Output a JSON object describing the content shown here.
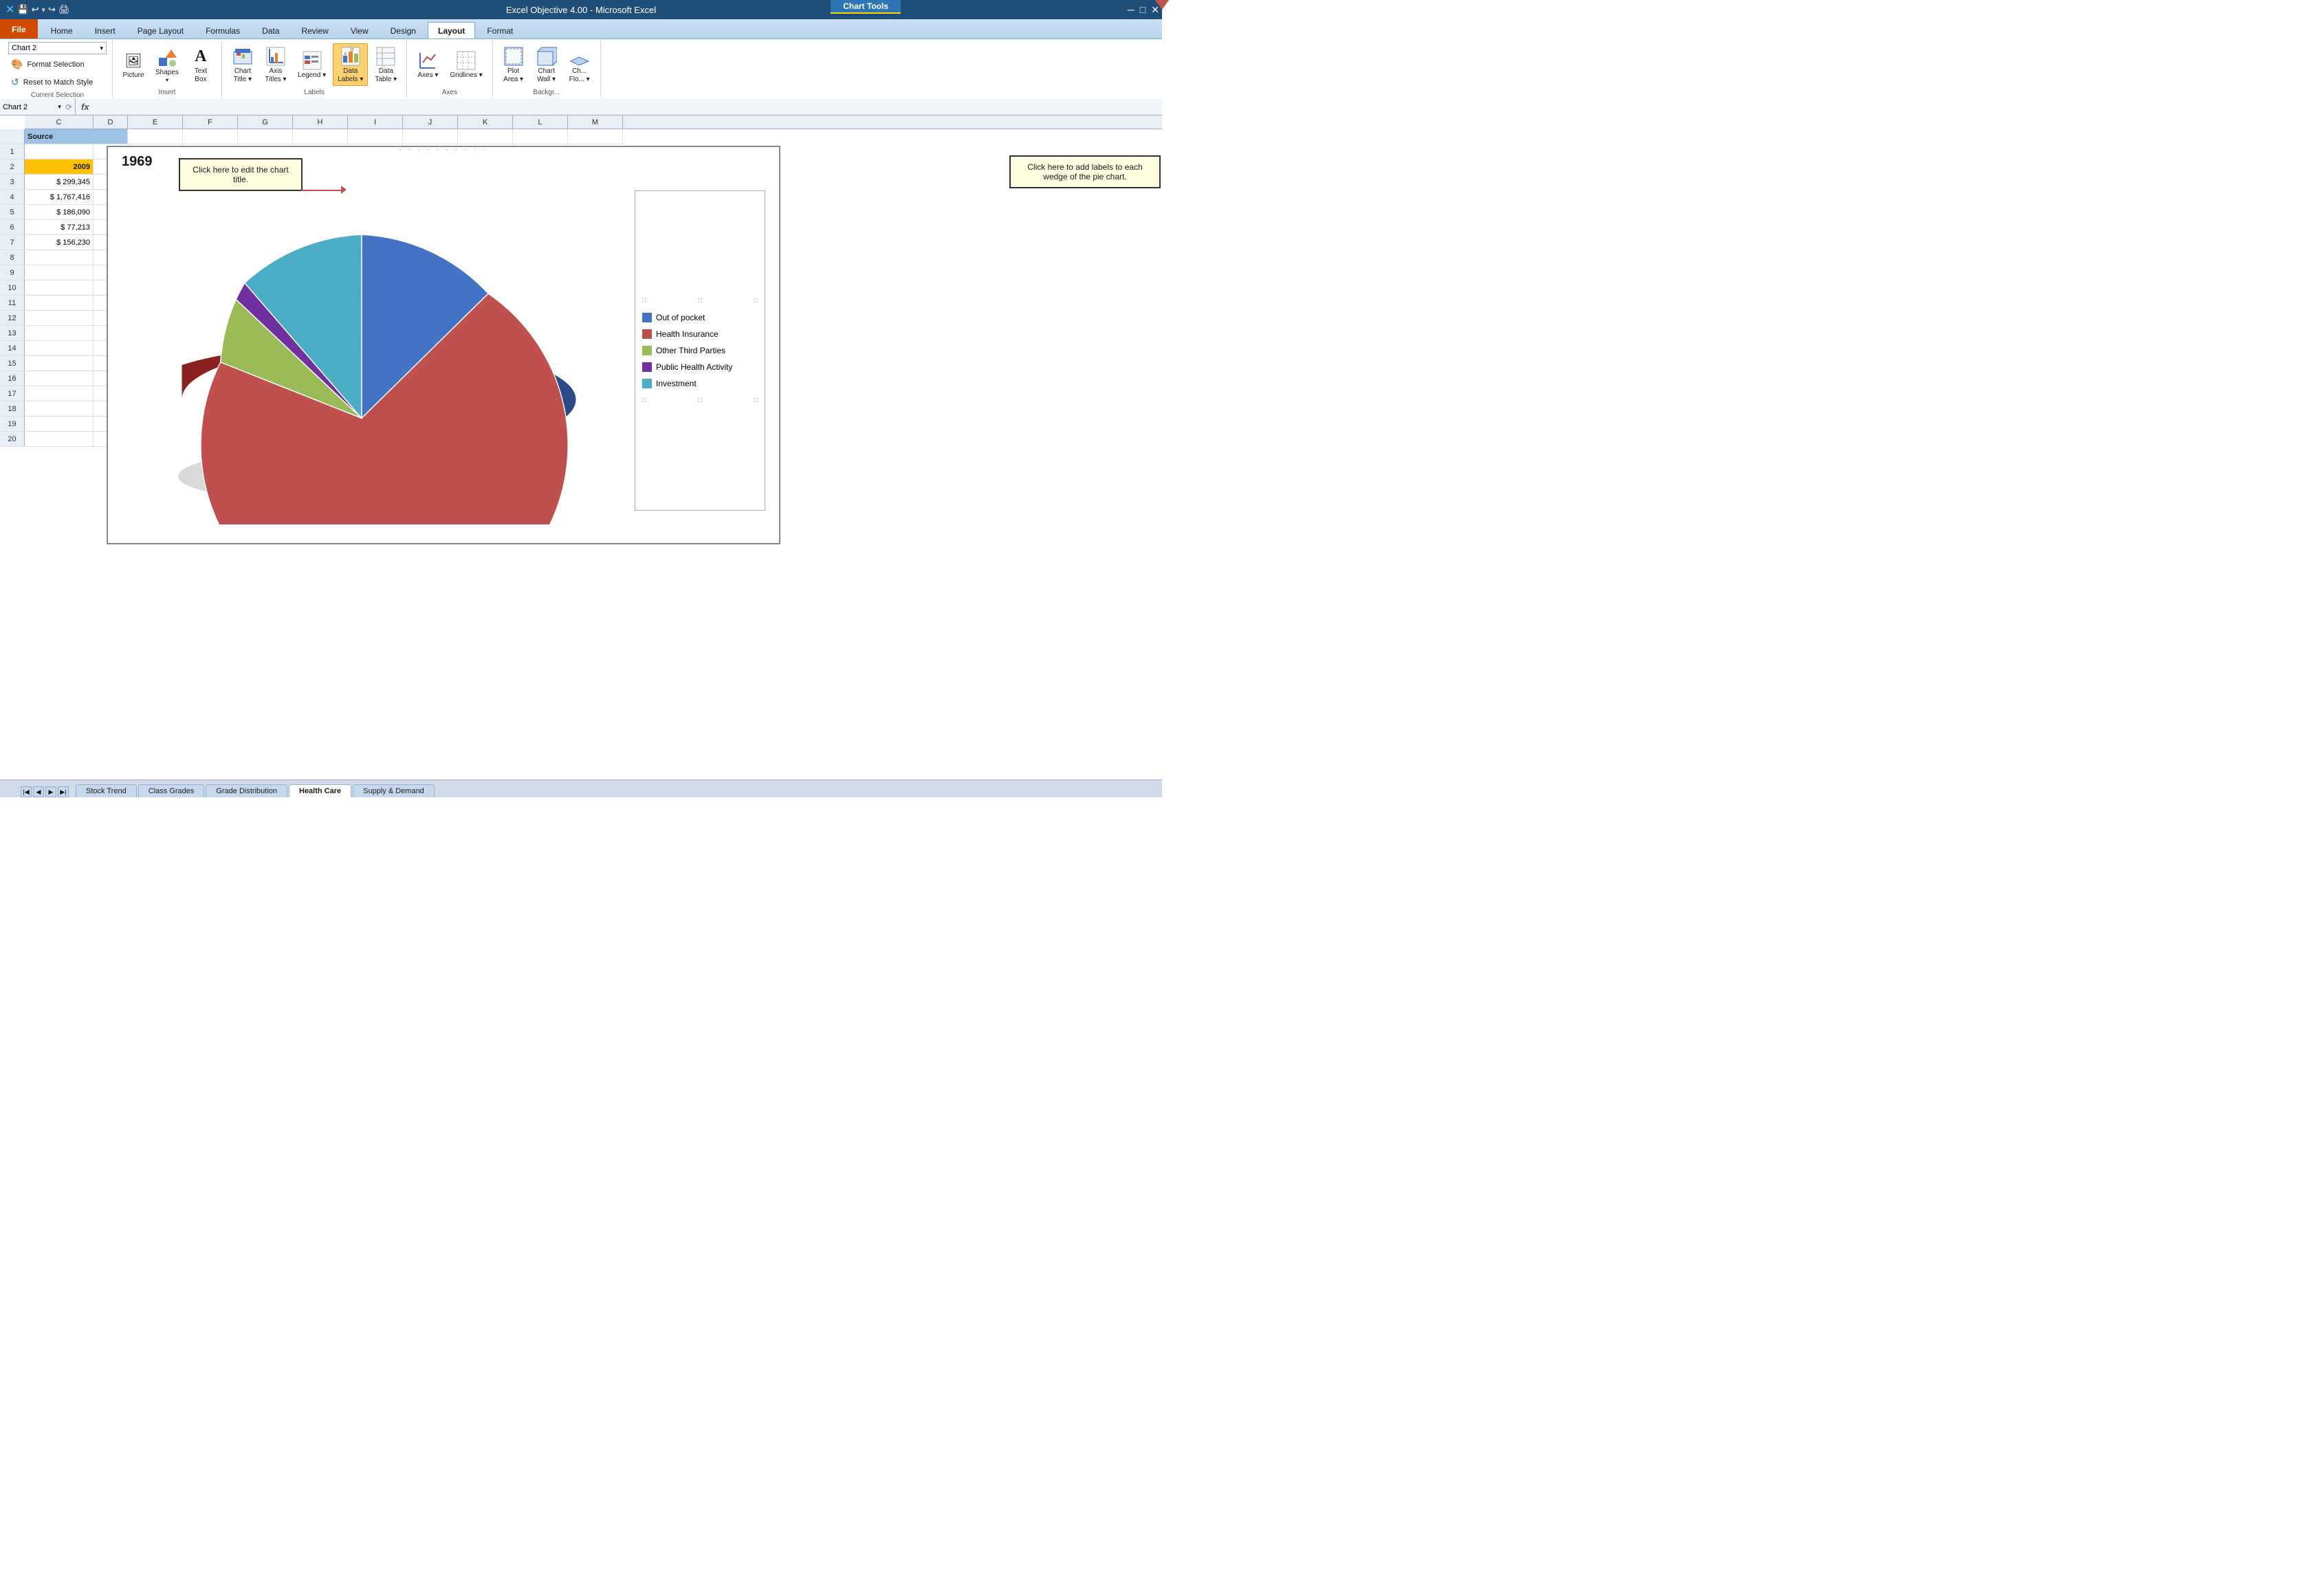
{
  "titleBar": {
    "title": "Excel Objective 4.00 - Microsoft Excel",
    "chartToolsBadge": "Chart Tools"
  },
  "ribbon": {
    "tabs": [
      {
        "id": "file",
        "label": "File",
        "type": "file"
      },
      {
        "id": "home",
        "label": "Home"
      },
      {
        "id": "insert",
        "label": "Insert"
      },
      {
        "id": "pageLayout",
        "label": "Page Layout"
      },
      {
        "id": "formulas",
        "label": "Formulas"
      },
      {
        "id": "data",
        "label": "Data"
      },
      {
        "id": "review",
        "label": "Review"
      },
      {
        "id": "view",
        "label": "View"
      },
      {
        "id": "design",
        "label": "Design"
      },
      {
        "id": "layout",
        "label": "Layout",
        "active": true
      },
      {
        "id": "format",
        "label": "Format"
      }
    ],
    "groups": {
      "currentSelection": {
        "label": "Current Selection",
        "selectorValue": "Chart 2",
        "formatBtn": "Format Selection",
        "resetBtn": "Reset to Match Style"
      },
      "insert": {
        "label": "Insert",
        "buttons": [
          {
            "id": "picture",
            "label": "Picture",
            "icon": "🖼"
          },
          {
            "id": "shapes",
            "label": "Shapes",
            "icon": "⬡"
          },
          {
            "id": "textBox",
            "label": "Text Box",
            "icon": "A"
          }
        ]
      },
      "labels": {
        "label": "Labels",
        "buttons": [
          {
            "id": "chartTitle",
            "label": "Chart Title",
            "icon": "📊"
          },
          {
            "id": "axisTitles",
            "label": "Axis Titles",
            "icon": "📈"
          },
          {
            "id": "legend",
            "label": "Legend",
            "icon": "☰"
          },
          {
            "id": "dataLabels",
            "label": "Data Labels",
            "icon": "📋",
            "active": true
          },
          {
            "id": "dataTable",
            "label": "Data Table",
            "icon": "▦"
          }
        ]
      },
      "axes": {
        "label": "Axes",
        "buttons": [
          {
            "id": "axes",
            "label": "Axes",
            "icon": "⊞"
          },
          {
            "id": "gridlines",
            "label": "Gridlines",
            "icon": "⊟"
          }
        ]
      },
      "background": {
        "label": "Background",
        "buttons": [
          {
            "id": "plotArea",
            "label": "Plot Area",
            "icon": "▣"
          },
          {
            "id": "chartWall",
            "label": "Chart Wall",
            "icon": "▢"
          },
          {
            "id": "chartFloor",
            "label": "Ch... Flo...",
            "icon": "▤"
          }
        ]
      }
    }
  },
  "formulaBar": {
    "cellRef": "Chart 2",
    "formula": "fx"
  },
  "spreadsheet": {
    "columns": [
      {
        "label": "C",
        "width": 100
      },
      {
        "label": "D",
        "width": 50
      },
      {
        "label": "E",
        "width": 80
      },
      {
        "label": "F",
        "width": 80
      },
      {
        "label": "G",
        "width": 80
      },
      {
        "label": "H",
        "width": 80
      },
      {
        "label": "I",
        "width": 80
      },
      {
        "label": "J",
        "width": 80
      },
      {
        "label": "K",
        "width": 80
      },
      {
        "label": "L",
        "width": 80
      },
      {
        "label": "M",
        "width": 80
      }
    ],
    "rows": [
      {
        "rowNum": "",
        "cells": [
          {
            "value": "Source",
            "type": "header-cell",
            "span": 2
          },
          {
            "value": "",
            "type": ""
          },
          {
            "value": "",
            "type": ""
          },
          {
            "value": "",
            "type": ""
          },
          {
            "value": "",
            "type": ""
          }
        ]
      },
      {
        "rowNum": "1",
        "cells": [
          {
            "value": "",
            "type": ""
          },
          {
            "value": "",
            "type": ""
          },
          {
            "value": "",
            "type": ""
          },
          {
            "value": "",
            "type": ""
          },
          {
            "value": "",
            "type": ""
          }
        ]
      },
      {
        "rowNum": "2",
        "cells": [
          {
            "value": "2009",
            "type": "year-cell"
          },
          {
            "value": "",
            "type": ""
          },
          {
            "value": "",
            "type": ""
          },
          {
            "value": "",
            "type": ""
          },
          {
            "value": "",
            "type": ""
          }
        ]
      },
      {
        "rowNum": "3",
        "cells": [
          {
            "value": "$ 299,345",
            "type": "money"
          },
          {
            "value": "",
            "type": ""
          },
          {
            "value": "",
            "type": ""
          },
          {
            "value": "",
            "type": ""
          },
          {
            "value": "",
            "type": ""
          }
        ]
      },
      {
        "rowNum": "4",
        "cells": [
          {
            "value": "$ 1,767,416",
            "type": "money"
          },
          {
            "value": "",
            "type": ""
          },
          {
            "value": "",
            "type": ""
          },
          {
            "value": "",
            "type": ""
          },
          {
            "value": "",
            "type": ""
          }
        ]
      },
      {
        "rowNum": "5",
        "cells": [
          {
            "value": "$ 186,090",
            "type": "money"
          },
          {
            "value": "",
            "type": ""
          },
          {
            "value": "",
            "type": ""
          },
          {
            "value": "",
            "type": ""
          },
          {
            "value": "",
            "type": ""
          }
        ]
      },
      {
        "rowNum": "6",
        "cells": [
          {
            "value": "$ 77,213",
            "type": "money"
          },
          {
            "value": "",
            "type": ""
          },
          {
            "value": "",
            "type": ""
          },
          {
            "value": "",
            "type": ""
          },
          {
            "value": "",
            "type": ""
          }
        ]
      },
      {
        "rowNum": "7",
        "cells": [
          {
            "value": "$ 156,230",
            "type": "money"
          },
          {
            "value": "",
            "type": ""
          },
          {
            "value": "",
            "type": ""
          },
          {
            "value": "",
            "type": ""
          },
          {
            "value": "",
            "type": ""
          }
        ]
      },
      {
        "rowNum": "8",
        "cells": [
          {
            "value": "",
            "type": ""
          },
          {
            "value": "",
            "type": ""
          },
          {
            "value": "",
            "type": ""
          },
          {
            "value": "",
            "type": ""
          },
          {
            "value": "",
            "type": ""
          }
        ]
      },
      {
        "rowNum": "9",
        "cells": [
          {
            "value": "",
            "type": ""
          },
          {
            "value": "",
            "type": ""
          },
          {
            "value": "",
            "type": ""
          },
          {
            "value": "",
            "type": ""
          },
          {
            "value": "",
            "type": ""
          }
        ]
      },
      {
        "rowNum": "10",
        "cells": [
          {
            "value": "",
            "type": ""
          },
          {
            "value": "",
            "type": ""
          },
          {
            "value": "",
            "type": ""
          },
          {
            "value": "",
            "type": ""
          },
          {
            "value": "",
            "type": ""
          }
        ]
      },
      {
        "rowNum": "11",
        "cells": [
          {
            "value": "",
            "type": ""
          },
          {
            "value": "",
            "type": ""
          },
          {
            "value": "",
            "type": ""
          },
          {
            "value": "",
            "type": ""
          },
          {
            "value": "",
            "type": ""
          }
        ]
      },
      {
        "rowNum": "12",
        "cells": [
          {
            "value": "",
            "type": ""
          },
          {
            "value": "",
            "type": ""
          },
          {
            "value": "",
            "type": ""
          },
          {
            "value": "",
            "type": ""
          },
          {
            "value": "",
            "type": ""
          }
        ]
      },
      {
        "rowNum": "13",
        "cells": [
          {
            "value": "",
            "type": ""
          },
          {
            "value": "",
            "type": ""
          },
          {
            "value": "",
            "type": ""
          },
          {
            "value": "",
            "type": ""
          },
          {
            "value": "",
            "type": ""
          }
        ]
      },
      {
        "rowNum": "14",
        "cells": [
          {
            "value": "",
            "type": ""
          },
          {
            "value": "",
            "type": ""
          },
          {
            "value": "",
            "type": ""
          },
          {
            "value": "",
            "type": ""
          },
          {
            "value": "",
            "type": ""
          }
        ]
      },
      {
        "rowNum": "15",
        "cells": [
          {
            "value": "",
            "type": ""
          },
          {
            "value": "",
            "type": ""
          },
          {
            "value": "",
            "type": ""
          },
          {
            "value": "",
            "type": ""
          },
          {
            "value": "",
            "type": ""
          }
        ]
      },
      {
        "rowNum": "16",
        "cells": [
          {
            "value": "",
            "type": ""
          },
          {
            "value": "",
            "type": ""
          },
          {
            "value": "",
            "type": ""
          },
          {
            "value": "",
            "type": ""
          },
          {
            "value": "",
            "type": ""
          }
        ]
      },
      {
        "rowNum": "17",
        "cells": [
          {
            "value": "",
            "type": ""
          },
          {
            "value": "",
            "type": ""
          },
          {
            "value": "",
            "type": ""
          },
          {
            "value": "",
            "type": ""
          },
          {
            "value": "",
            "type": ""
          }
        ]
      },
      {
        "rowNum": "18",
        "cells": [
          {
            "value": "",
            "type": ""
          },
          {
            "value": "",
            "type": ""
          },
          {
            "value": "",
            "type": ""
          },
          {
            "value": "",
            "type": ""
          },
          {
            "value": "",
            "type": ""
          }
        ]
      },
      {
        "rowNum": "19",
        "cells": [
          {
            "value": "",
            "type": ""
          },
          {
            "value": "",
            "type": ""
          },
          {
            "value": "",
            "type": ""
          },
          {
            "value": "",
            "type": ""
          },
          {
            "value": "",
            "type": ""
          }
        ]
      },
      {
        "rowNum": "20",
        "cells": [
          {
            "value": "",
            "type": ""
          },
          {
            "value": "",
            "type": ""
          },
          {
            "value": "",
            "type": ""
          },
          {
            "value": "",
            "type": ""
          },
          {
            "value": "",
            "type": ""
          }
        ]
      }
    ]
  },
  "chart": {
    "title": "1969",
    "legend": [
      {
        "label": "Out of pocket",
        "color": "#4472c4"
      },
      {
        "label": "Health Insurance",
        "color": "#c0504d"
      },
      {
        "label": "Other Third Parties",
        "color": "#9bbb59"
      },
      {
        "label": "Public Health Activity",
        "color": "#7030a0"
      },
      {
        "label": "Investment",
        "color": "#4bacc6"
      }
    ],
    "pieData": [
      {
        "label": "Out of pocket",
        "value": 299345,
        "color": "#4472c4",
        "startAngle": 0,
        "endAngle": 44
      },
      {
        "label": "Health Insurance",
        "value": 1767416,
        "color": "#c0504d",
        "startAngle": 44,
        "endAngle": 264
      },
      {
        "label": "Other Third Parties",
        "value": 186090,
        "color": "#9bbb59",
        "startAngle": 264,
        "endAngle": 292
      },
      {
        "label": "Public Health Activity",
        "value": 77213,
        "color": "#7030a0",
        "startAngle": 292,
        "endAngle": 304
      },
      {
        "label": "Investment",
        "value": 156230,
        "color": "#4bacc6",
        "startAngle": 304,
        "endAngle": 360
      }
    ]
  },
  "callouts": {
    "chartTitle": "Click here to edit the chart title.",
    "dataLabels": "Click here to add labels to each wedge of the pie chart."
  },
  "sheetTabs": [
    {
      "label": "Stock Trend"
    },
    {
      "label": "Class Grades"
    },
    {
      "label": "Grade Distribution"
    },
    {
      "label": "Health Care",
      "active": true
    },
    {
      "label": "Supply & Demand"
    }
  ]
}
